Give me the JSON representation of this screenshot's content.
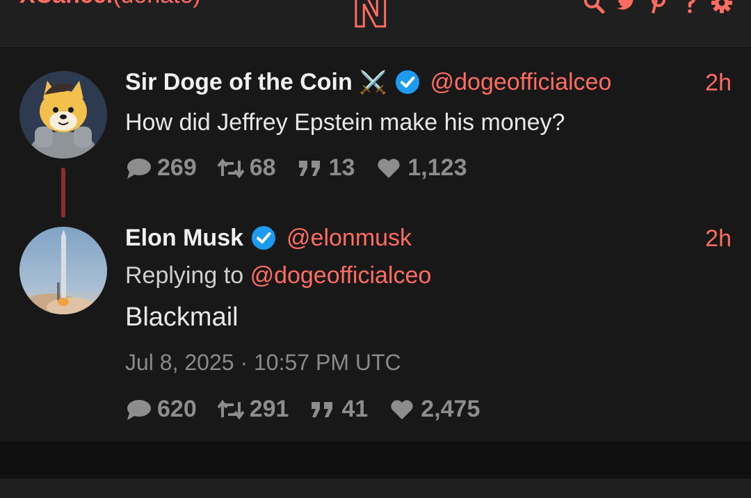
{
  "nav": {
    "brand": "XCancel",
    "donate": "(donate)",
    "logo_letter": "N",
    "icons": [
      "search-icon",
      "twitter-icon",
      "pinterest-icon",
      "help-icon",
      "gear-icon"
    ]
  },
  "tweets": [
    {
      "fullname": "Sir Doge of the Coin",
      "emoji": "⚔️",
      "verified": true,
      "username": "@dogeofficialceo",
      "time": "2h",
      "text": "How did Jeffrey Epstein make his money?",
      "stats": {
        "replies": "269",
        "retweets": "68",
        "quotes": "13",
        "likes": "1,123"
      }
    },
    {
      "fullname": "Elon Musk",
      "verified": true,
      "username": "@elonmusk",
      "time": "2h",
      "replying_prefix": "Replying to",
      "replying_to": "@dogeofficialceo",
      "text": "Blackmail",
      "date": "Jul 8, 2025 · 10:57 PM UTC",
      "stats": {
        "replies": "620",
        "retweets": "291",
        "quotes": "41",
        "likes": "2,475"
      }
    }
  ],
  "colors": {
    "accent": "#ff6c60",
    "background": "#181818",
    "verified": "#1d9bf0"
  }
}
